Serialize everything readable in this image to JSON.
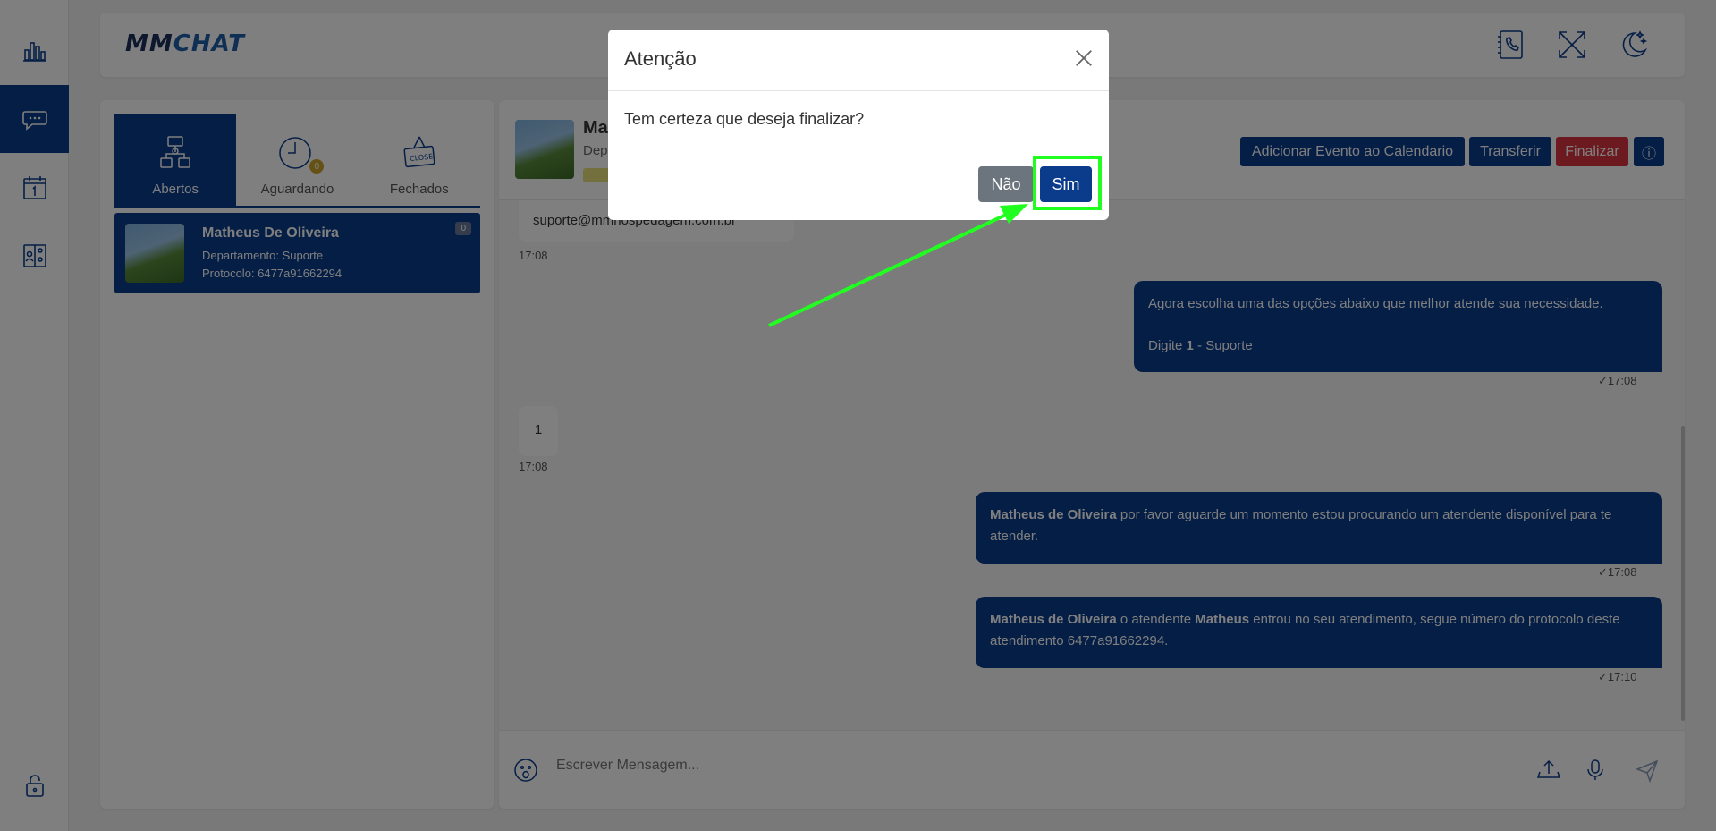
{
  "app": {
    "logo_mm": "MM",
    "logo_chat": "CHAT"
  },
  "rail": {
    "items": [
      "dashboard",
      "chat",
      "calendar",
      "contacts"
    ],
    "active": "chat"
  },
  "tabs": [
    {
      "label": "Abertos",
      "active": true
    },
    {
      "label": "Aguardando",
      "badge": "0",
      "active": false
    },
    {
      "label": "Fechados",
      "icon_text": "CLOSE",
      "active": false
    }
  ],
  "conversation": {
    "name": "Matheus De Oliveira",
    "department": "Departamento: Suporte",
    "protocol": "Protocolo: 6477a91662294",
    "count": "0"
  },
  "chat_header": {
    "name_partial": "Ma",
    "dept_partial": "Dep",
    "buttons": {
      "add_event": "Adicionar Evento ao Calendario",
      "transfer": "Transferir",
      "finish": "Finalizar",
      "info": "ⓘ"
    }
  },
  "messages": [
    {
      "dir": "in",
      "text": "suporte@mmhospedagem.com.br",
      "time": "17:08"
    },
    {
      "dir": "out",
      "line1": "Agora escolha uma das opções abaixo que melhor atende sua necessidade.",
      "line2_pre": "Digite ",
      "line2_bold": "1",
      "line2_post": " - Suporte",
      "time": "17:08"
    },
    {
      "dir": "in",
      "text": "1",
      "time": "17:08"
    },
    {
      "dir": "out",
      "bold1": "Matheus de Oliveira",
      "text1": " por favor aguarde um momento estou procurando um atendente disponível para te atender.",
      "time": "17:08"
    },
    {
      "dir": "out",
      "bold1": "Matheus de Oliveira",
      "text1": " o atendente ",
      "bold2": "Matheus",
      "text2": " entrou no seu atendimento, segue número do protocolo deste atendimento 6477a91662294.",
      "time": "17:10"
    }
  ],
  "composer": {
    "placeholder": "Escrever Mensagem..."
  },
  "modal": {
    "title": "Atenção",
    "body": "Tem certeza que deseja finalizar?",
    "no_label": "Não",
    "yes_label": "Sim"
  },
  "colors": {
    "primary": "#0b3c8c",
    "danger": "#d9353f",
    "secondary": "#6c757d",
    "highlight": "#21ff21"
  }
}
